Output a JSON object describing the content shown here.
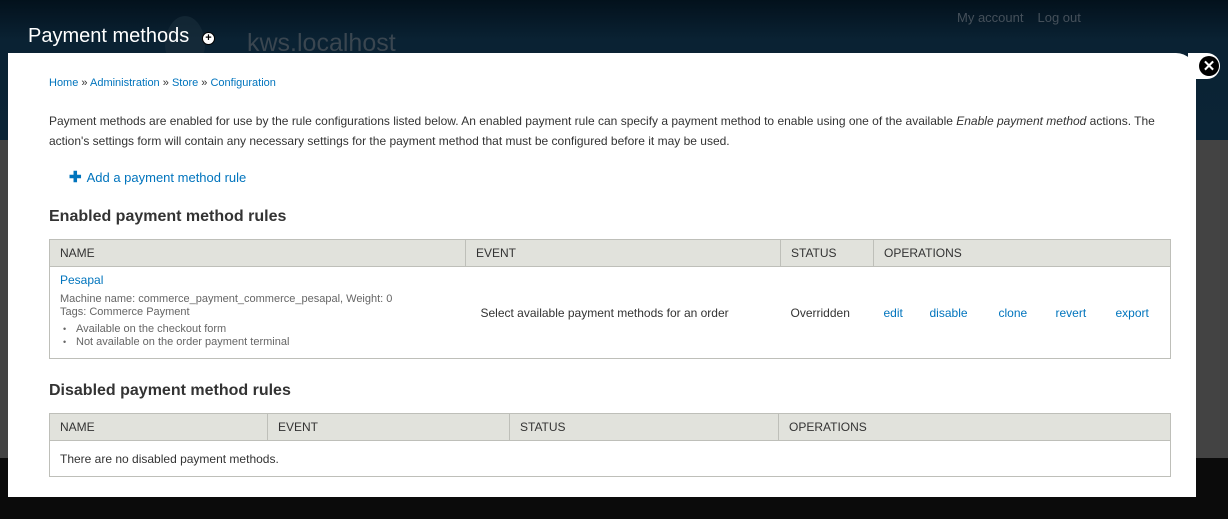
{
  "background": {
    "page_title": "Payment methods",
    "site_name": "kws.localhost",
    "secondary_menu": [
      "My account",
      "Log out"
    ]
  },
  "overlay": {
    "close_icon": "close-circle-icon",
    "breadcrumb": [
      "Home",
      "Administration",
      "Store",
      "Configuration"
    ],
    "breadcrumb_separator": "»",
    "intro_part1": "Payment methods are enabled for use by the rule configurations listed below. An enabled payment rule can specify a payment method to enable using one of the available ",
    "intro_em": "Enable payment method",
    "intro_part2": " actions. The action's settings form will contain any necessary settings for the payment method that must be configured before it may be used.",
    "add_rule_label": "Add a payment method rule",
    "enabled_section": {
      "title": "Enabled payment method rules",
      "columns": [
        "NAME",
        "EVENT",
        "STATUS",
        "OPERATIONS"
      ],
      "rows": [
        {
          "name": "Pesapal",
          "machine_name_line": "Machine name: commerce_payment_commerce_pesapal, Weight: 0",
          "tags_line": "Tags: Commerce Payment",
          "notes": [
            "Available on the checkout form",
            "Not available on the order payment terminal"
          ],
          "event": "Select available payment methods for an order",
          "status": "Overridden",
          "operations": [
            "edit",
            "disable",
            "clone",
            "revert",
            "export"
          ]
        }
      ]
    },
    "disabled_section": {
      "title": "Disabled payment method rules",
      "columns": [
        "NAME",
        "EVENT",
        "STATUS",
        "OPERATIONS"
      ],
      "empty_message": "There are no disabled payment methods."
    }
  },
  "colors": {
    "link": "#0074bd",
    "table_header_bg": "#e1e2dc",
    "header_bg": "#0b2436"
  }
}
